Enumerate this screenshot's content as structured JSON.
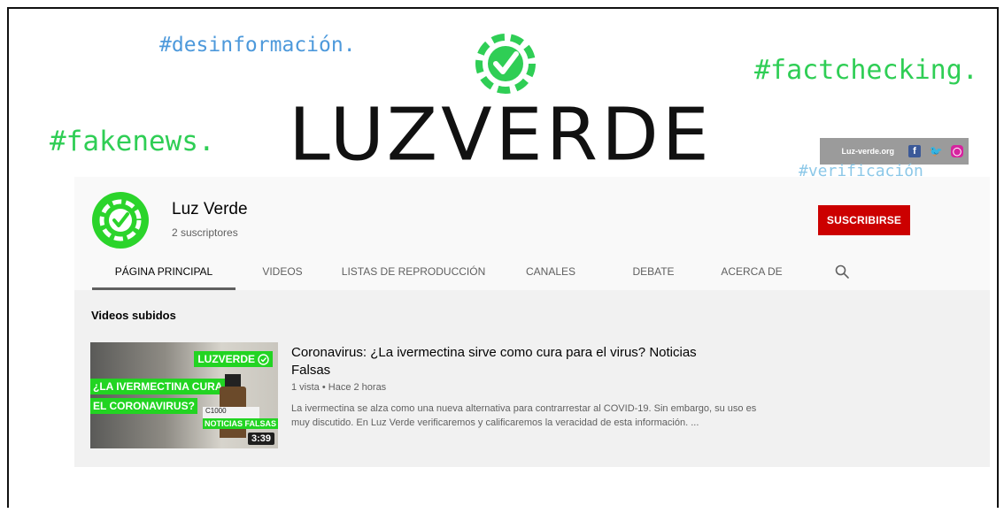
{
  "banner": {
    "tags": {
      "desinformacion": "#desinformación.",
      "factchecking": "#factchecking.",
      "fakenews": "#fakenews.",
      "verificacion": "#verificación"
    },
    "brand_icon": "check-badge-icon",
    "brand_word": "LUZVERDE",
    "social": {
      "site": "Luz-verde.org",
      "icons": [
        "facebook-icon",
        "twitter-icon",
        "instagram-icon"
      ]
    }
  },
  "channel": {
    "avatar_icon": "check-badge-icon",
    "name": "Luz Verde",
    "subscribers": "2 suscriptores",
    "subscribe_label": "SUSCRIBIRSE",
    "subscribe_color": "#cc0000",
    "tabs": [
      {
        "label": "PÁGINA PRINCIPAL",
        "active": true
      },
      {
        "label": "VIDEOS",
        "active": false
      },
      {
        "label": "LISTAS DE REPRODUCCIÓN",
        "active": false
      },
      {
        "label": "CANALES",
        "active": false
      },
      {
        "label": "DEBATE",
        "active": false
      },
      {
        "label": "ACERCA DE",
        "active": false
      }
    ],
    "search_icon": "search-icon"
  },
  "content": {
    "section_title": "Videos subidos",
    "video": {
      "thumbnail": {
        "brand": "LUZVERDE",
        "question_line1": "¿LA IVERMECTINA CURA",
        "question_line2": "EL CORONAVIRUS?",
        "label": "C1000",
        "badge": "NOTICIAS FALSAS",
        "duration": "3:39"
      },
      "title": "Coronavirus: ¿La ivermectina sirve como cura para el virus? Noticias Falsas",
      "meta": "1 vista • Hace 2 horas",
      "description": "La ivermectina se alza como una nueva alternativa para contrarrestar al COVID-19. Sin embargo, su uso es muy discutido. En Luz Verde verificaremos y calificaremos la veracidad de esta información. ..."
    }
  },
  "colors": {
    "brand_green": "#2fce55",
    "avatar_green": "#2bd42b",
    "subscribe_red": "#cc0000"
  }
}
